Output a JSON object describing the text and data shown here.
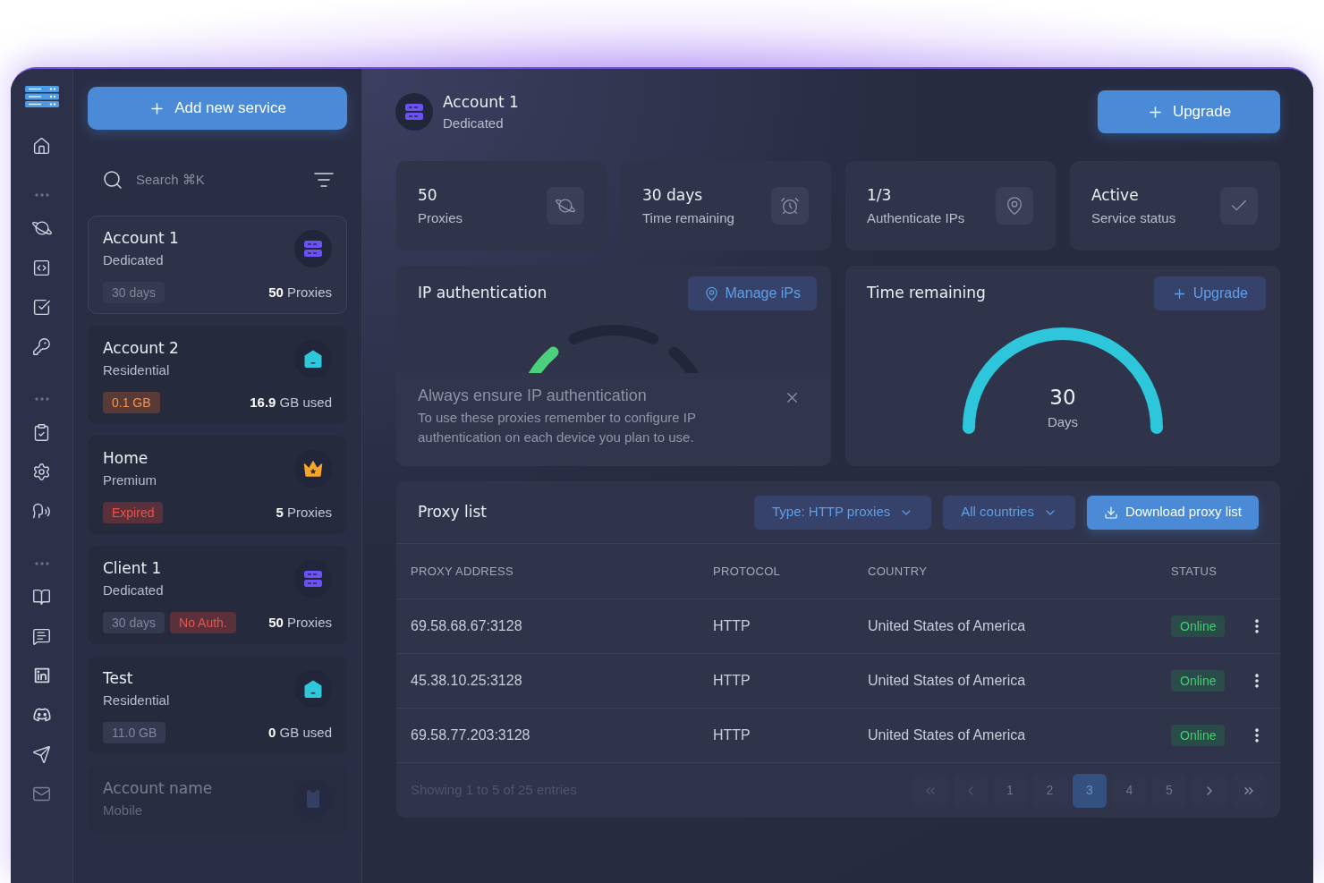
{
  "services": {
    "add_button": "Add new service",
    "search": {
      "placeholder": "Search ⌘K"
    },
    "items": [
      {
        "name": "Account 1",
        "plan": "Dedicated",
        "kind": "dedicated",
        "selected": true,
        "faded": false,
        "tags": [
          {
            "text": "30 days",
            "kind": "neutral"
          }
        ],
        "amount": "**50** Proxies"
      },
      {
        "name": "Account 2",
        "plan": "Residential",
        "kind": "residential",
        "selected": false,
        "faded": false,
        "tags": [
          {
            "text": "0.1 GB",
            "kind": "warning"
          }
        ],
        "amount": "**16.9** GB used"
      },
      {
        "name": "Home",
        "plan": "Premium",
        "kind": "premium",
        "selected": false,
        "faded": false,
        "tags": [
          {
            "text": "Expired",
            "kind": "danger"
          }
        ],
        "amount": "**5** Proxies"
      },
      {
        "name": "Client 1",
        "plan": "Dedicated",
        "kind": "dedicated",
        "selected": false,
        "faded": false,
        "tags": [
          {
            "text": "30 days",
            "kind": "neutral"
          },
          {
            "text": "No Auth.",
            "kind": "danger"
          }
        ],
        "amount": "**50** Proxies"
      },
      {
        "name": "Test",
        "plan": "Residential",
        "kind": "residential",
        "selected": false,
        "faded": false,
        "tags": [
          {
            "text": "11.0 GB",
            "kind": "neutral"
          }
        ],
        "amount": "**0** GB used"
      },
      {
        "name": "Account name",
        "plan": "Mobile",
        "kind": "mobile",
        "selected": false,
        "faded": true
      }
    ]
  },
  "header": {
    "title": "Account 1",
    "subtitle": "Dedicated",
    "kind": "dedicated",
    "upgrade_button": "Upgrade"
  },
  "stats": [
    {
      "value": "50",
      "label": "Proxies",
      "kind": "planet"
    },
    {
      "value": "30 days",
      "label": "Time remaining",
      "kind": "alarm"
    },
    {
      "value": "1/3",
      "label": "Authenticate IPs",
      "kind": "location"
    },
    {
      "value": "Active",
      "label": "Service status",
      "kind": "check"
    }
  ],
  "ip_authentication": {
    "title": "IP authentication",
    "button": "Manage iPs",
    "notice": {
      "title": "Always ensure IP authentication",
      "text": "To use these proxies remember to configure IP authentication on each device you plan to use."
    }
  },
  "time_remaining": {
    "title": "Time remaining",
    "button": "Upgrade",
    "gauge": {
      "value": "30",
      "unit": "Days",
      "level": 1
    }
  },
  "proxy_list": {
    "title": "Proxy list",
    "filters": [
      "Type: HTTP proxies",
      "All countries"
    ],
    "download_button": "Download proxy list",
    "columns": [
      "PROXY ADDRESS",
      "PROTOCOL",
      "COUNTRY",
      "STATUS"
    ],
    "rows": [
      {
        "address": "69.58.68.67:3128",
        "protocol": "HTTP",
        "country": "United States of America",
        "status": "Online",
        "online": true
      },
      {
        "address": "45.38.10.25:3128",
        "protocol": "HTTP",
        "country": "United States of America",
        "status": "Online",
        "online": true
      },
      {
        "address": "69.58.77.203:3128",
        "protocol": "HTTP",
        "country": "United States of America",
        "status": "Online",
        "online": true
      }
    ],
    "footer": "Showing 1 to 5 of 25 entries",
    "pages": [
      {
        "label": "1",
        "selected": false
      },
      {
        "label": "2",
        "selected": false
      },
      {
        "label": "3",
        "selected": true
      },
      {
        "label": "4",
        "selected": false
      },
      {
        "label": "5",
        "selected": false
      }
    ]
  }
}
